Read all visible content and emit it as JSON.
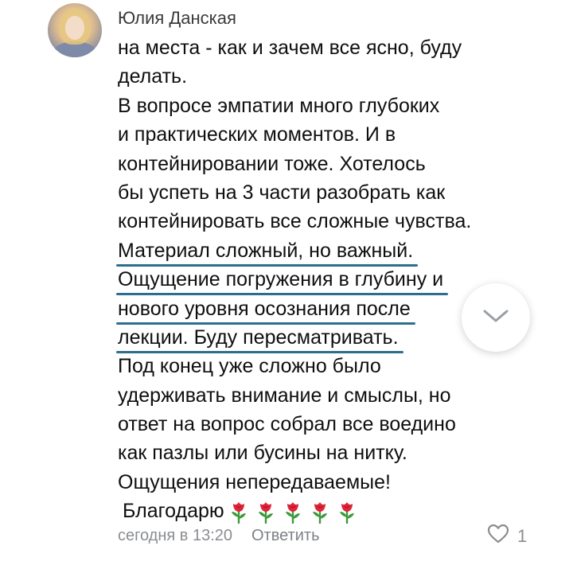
{
  "comment": {
    "author": "Юлия Данская",
    "lines": [
      "на места - как и зачем все ясно, буду",
      "делать.",
      "В вопросе эмпатии много глубоких",
      "и практических моментов. И в",
      "контейнировании тоже. Хотелось",
      "бы успеть на 3 части разобрать как",
      "контейнировать все сложные чувства.",
      "Материал сложный, но важный.",
      "Ощущение погружения в глубину  и",
      "нового уровня осознания после",
      "лекции. Буду пересматривать.",
      "Под конец уже сложно было",
      "удерживать внимание и смыслы, но",
      "ответ на вопрос собрал все воедино",
      "как пазлы или бусины на нитку.",
      "Ощущения непередаваемые!",
      "Благодарю"
    ],
    "emoji": [
      "rose-emoji",
      "rose-emoji",
      "rose-emoji",
      "rose-emoji",
      "rose-emoji"
    ],
    "timestamp": "сегодня в 13:20",
    "reply_label": "Ответить",
    "like_count": "1"
  },
  "icons": {
    "scroll_down": "chevron-down-icon",
    "like": "heart-outline-icon"
  },
  "colors": {
    "underline": "#2b6f8e",
    "meta_text": "#8a8d91",
    "rose_red": "#e0243a",
    "rose_green": "#3c9a3a"
  }
}
